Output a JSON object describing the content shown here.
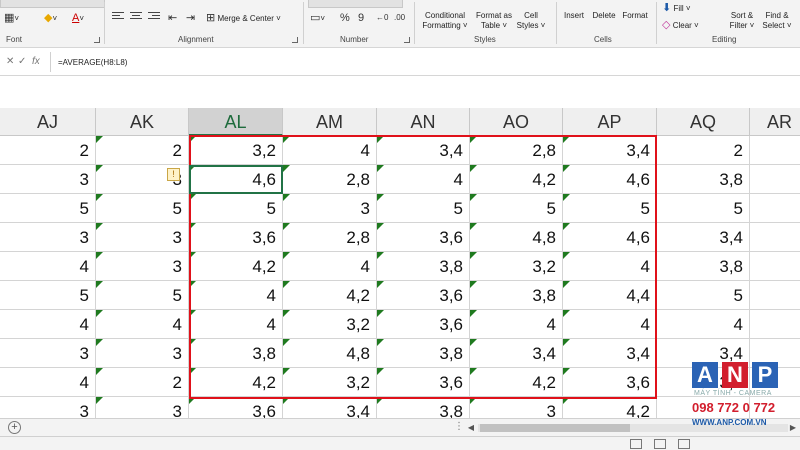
{
  "ribbon": {
    "groups": {
      "font": "Font",
      "alignment": "Alignment",
      "number": "Number",
      "styles": "Styles",
      "cells": "Cells",
      "editing": "Editing"
    },
    "merge_center": "Merge & Center",
    "percent": "%",
    "comma": "9",
    "conditional_formatting": [
      "Conditional",
      "Formatting ˅"
    ],
    "format_as_table": [
      "Format as",
      "Table ˅"
    ],
    "cell_styles": [
      "Cell",
      "Styles ˅"
    ],
    "insert": "Insert",
    "delete": "Delete",
    "format": "Format",
    "fill": "Fill ˅",
    "clear": "Clear ˅",
    "sort_filter": [
      "Sort &",
      "Filter ˅"
    ],
    "find_select": [
      "Find &",
      "Select ˅"
    ],
    "icons": {
      "borders": "borders-icon",
      "fill_color": "fill-color-icon",
      "font_color": "font-color-icon",
      "align": "align-icon",
      "currency": "currency-icon",
      "percent": "percent-icon",
      "insert": "insert-cells-icon",
      "delete": "delete-cells-icon",
      "format": "format-cells-icon",
      "fill": "fill-down-icon",
      "clear": "eraser-icon",
      "sort": "sort-filter-icon",
      "find": "binoculars-icon"
    }
  },
  "formula_bar": {
    "cancel": "✕",
    "enter": "✓",
    "fx": "fx",
    "formula": "=AVERAGE(H8:L8)"
  },
  "columns": [
    {
      "label": "AJ",
      "active": false
    },
    {
      "label": "AK",
      "active": false
    },
    {
      "label": "AL",
      "active": true
    },
    {
      "label": "AM",
      "active": false
    },
    {
      "label": "AN",
      "active": false
    },
    {
      "label": "AO",
      "active": false
    },
    {
      "label": "AP",
      "active": false
    },
    {
      "label": "AQ",
      "active": false
    },
    {
      "label": "AR",
      "active": false
    }
  ],
  "rows": [
    [
      "2",
      "2",
      "3,2",
      "4",
      "3,4",
      "2,8",
      "3,4",
      "2",
      ""
    ],
    [
      "3",
      "3",
      "4,6",
      "2,8",
      "4",
      "4,2",
      "4,6",
      "3,8",
      ""
    ],
    [
      "5",
      "5",
      "5",
      "3",
      "5",
      "5",
      "5",
      "5",
      ""
    ],
    [
      "3",
      "3",
      "3,6",
      "2,8",
      "3,6",
      "4,8",
      "4,6",
      "3,4",
      ""
    ],
    [
      "4",
      "3",
      "4,2",
      "4",
      "3,8",
      "3,2",
      "4",
      "3,8",
      ""
    ],
    [
      "5",
      "5",
      "4",
      "4,2",
      "3,6",
      "3,8",
      "4,4",
      "5",
      ""
    ],
    [
      "4",
      "4",
      "4",
      "3,2",
      "3,6",
      "4",
      "4",
      "4",
      ""
    ],
    [
      "3",
      "3",
      "3,8",
      "4,8",
      "3,8",
      "3,4",
      "3,4",
      "3,4",
      ""
    ],
    [
      "4",
      "2",
      "4,2",
      "3,2",
      "3,6",
      "4,2",
      "3,6",
      "3,4",
      ""
    ],
    [
      "3",
      "3",
      "3,6",
      "3,4",
      "3,8",
      "3",
      "4,2",
      "",
      ""
    ]
  ],
  "error_indicator": "!",
  "sheet_bar": {
    "add_sheet": "+",
    "more": "⋮",
    "scroll_left": "◀",
    "scroll_right": "▶"
  },
  "watermark": {
    "letters": [
      "A",
      "N",
      "P"
    ],
    "letter_colors": [
      "#2b63b5",
      "#d21e2d",
      "#2b63b5"
    ],
    "subtitle": "MÁY TÍNH - CAMERA",
    "phone": "098 772 0 772",
    "url": "WWW.ANP.COM.VN"
  },
  "colors": {
    "selection": "#e0111a",
    "active_cell": "#217346",
    "error_triangle": "#1f7a1f"
  }
}
